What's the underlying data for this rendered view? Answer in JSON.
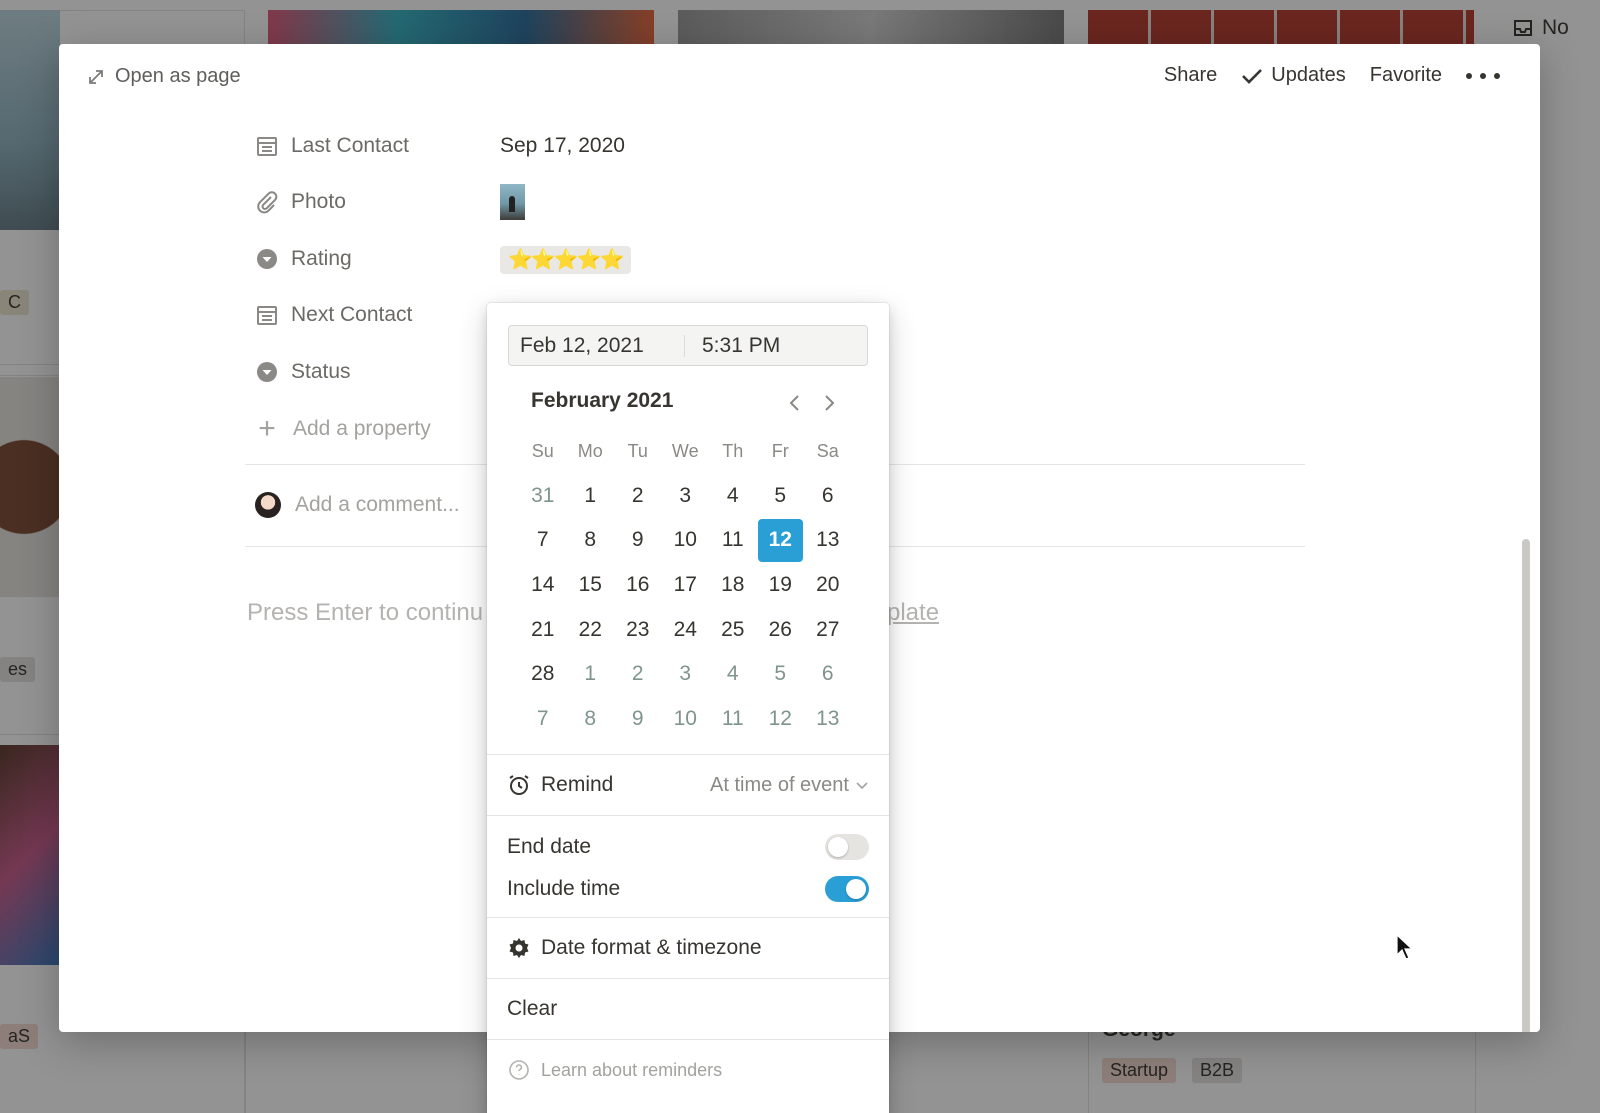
{
  "background": {
    "right_corner_label": "No",
    "george_card": {
      "name": "George",
      "tags": [
        {
          "label": "Startup",
          "color": "#f4d9d0"
        },
        {
          "label": "B2B",
          "color": "#e3e2e0"
        }
      ]
    },
    "left_tags": [
      "C",
      "es",
      "aS"
    ]
  },
  "topbar": {
    "open_as_page": "Open as page",
    "share": "Share",
    "updates": "Updates",
    "favorite": "Favorite"
  },
  "properties": [
    {
      "name": "Last Contact",
      "icon": "calendar-icon",
      "value": "Sep 17, 2020"
    },
    {
      "name": "Photo",
      "icon": "paperclip-icon",
      "value": ""
    },
    {
      "name": "Rating",
      "icon": "select-icon",
      "value": "⭐⭐⭐⭐⭐"
    },
    {
      "name": "Next Contact",
      "icon": "calendar-icon",
      "value": ""
    },
    {
      "name": "Status",
      "icon": "select-icon",
      "value": ""
    }
  ],
  "add_property": "Add a property",
  "comment_placeholder": "Add a comment...",
  "body_hint": "Press Enter to continu",
  "body_hint_link": "plate",
  "picker": {
    "date": "Feb 12, 2021",
    "time": "5:31 PM",
    "month": "February 2021",
    "weekdays": [
      "Su",
      "Mo",
      "Tu",
      "We",
      "Th",
      "Fr",
      "Sa"
    ],
    "selected_day": "12",
    "days": [
      {
        "d": "31",
        "m": true
      },
      {
        "d": "1"
      },
      {
        "d": "2"
      },
      {
        "d": "3"
      },
      {
        "d": "4"
      },
      {
        "d": "5"
      },
      {
        "d": "6"
      },
      {
        "d": "7"
      },
      {
        "d": "8"
      },
      {
        "d": "9"
      },
      {
        "d": "10"
      },
      {
        "d": "11"
      },
      {
        "d": "12",
        "s": true
      },
      {
        "d": "13"
      },
      {
        "d": "14"
      },
      {
        "d": "15"
      },
      {
        "d": "16"
      },
      {
        "d": "17"
      },
      {
        "d": "18"
      },
      {
        "d": "19"
      },
      {
        "d": "20"
      },
      {
        "d": "21"
      },
      {
        "d": "22"
      },
      {
        "d": "23"
      },
      {
        "d": "24"
      },
      {
        "d": "25"
      },
      {
        "d": "26"
      },
      {
        "d": "27"
      },
      {
        "d": "28"
      },
      {
        "d": "1",
        "m": true
      },
      {
        "d": "2",
        "m": true
      },
      {
        "d": "3",
        "m": true
      },
      {
        "d": "4",
        "m": true
      },
      {
        "d": "5",
        "m": true
      },
      {
        "d": "6",
        "m": true
      },
      {
        "d": "7",
        "m": true
      },
      {
        "d": "8",
        "m": true
      },
      {
        "d": "9",
        "m": true
      },
      {
        "d": "10",
        "m": true
      },
      {
        "d": "11",
        "m": true
      },
      {
        "d": "12",
        "m": true
      },
      {
        "d": "13",
        "m": true
      }
    ],
    "remind_label": "Remind",
    "remind_value": "At time of event",
    "end_date_label": "End date",
    "end_date_on": false,
    "include_time_label": "Include time",
    "include_time_on": true,
    "date_format_label": "Date format & timezone",
    "clear_label": "Clear",
    "learn_label": "Learn about reminders",
    "accent": "#2a9fd6"
  }
}
